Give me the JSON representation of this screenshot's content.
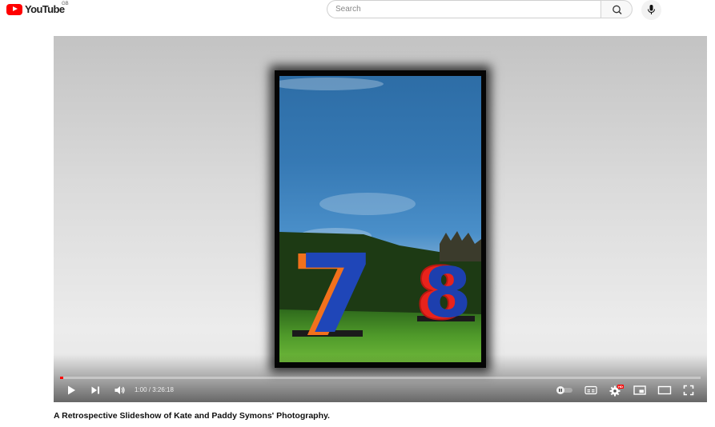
{
  "header": {
    "logo_text": "YouTube",
    "country_code": "GB",
    "search": {
      "placeholder": "Search",
      "value": ""
    }
  },
  "player": {
    "progress_fraction": 0.005,
    "time": {
      "current": "1:00",
      "separator": " / ",
      "duration": "3:26:18"
    },
    "settings_badge": "HD",
    "photo": {
      "numerals": [
        "7",
        "8"
      ]
    }
  },
  "video": {
    "title": "A Retrospective Slideshow of Kate and Paddy Symons' Photography."
  },
  "colors": {
    "brand_red": "#ff0000",
    "search_border": "#cfcfcf",
    "photo_sky": "#3679b4",
    "numeral_blue": "#1d3fae",
    "numeral_orange": "#f2711c",
    "numeral_red": "#e8231c"
  },
  "icons": [
    "youtube-logo-icon",
    "search-icon",
    "mic-icon",
    "play-icon",
    "next-icon",
    "volume-icon",
    "autoplay-toggle-icon",
    "subtitles-icon",
    "settings-icon",
    "miniplayer-icon",
    "theater-mode-icon",
    "fullscreen-icon"
  ]
}
